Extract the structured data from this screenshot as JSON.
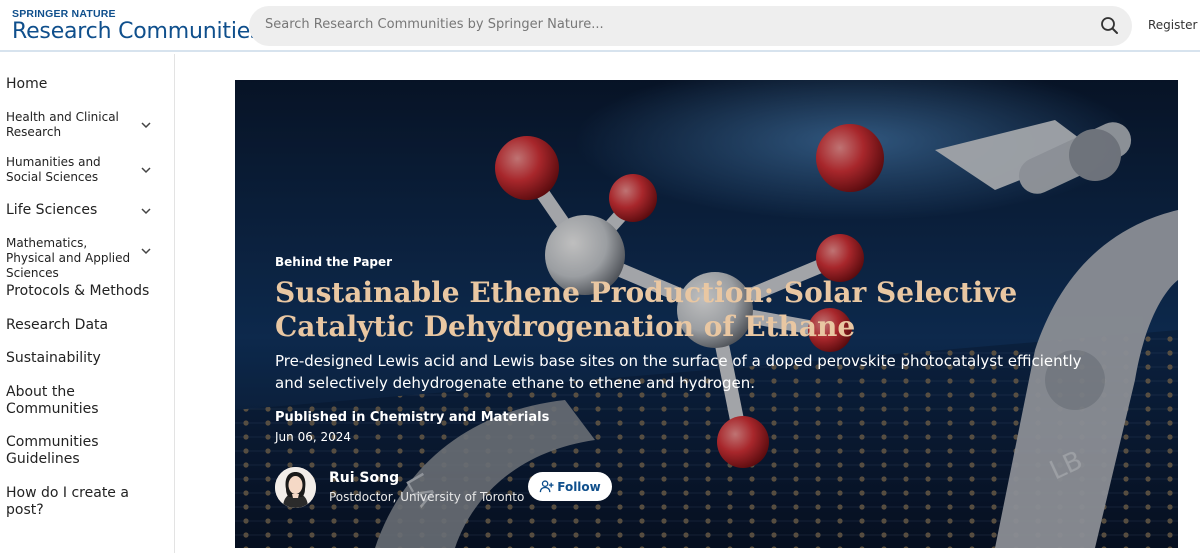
{
  "header": {
    "brand_top": "SPRINGER NATURE",
    "brand_main": "Research Communities",
    "search_placeholder": "Search Research Communities by Springer Nature...",
    "register_label": "Register"
  },
  "sidebar": {
    "items": [
      {
        "label": "Home",
        "has_chevron": false
      },
      {
        "label": "Health and Clinical Research",
        "has_chevron": true
      },
      {
        "label": "Humanities and Social Sciences",
        "has_chevron": true
      },
      {
        "label": "Life Sciences",
        "has_chevron": true
      },
      {
        "label": "Mathematics, Physical and Applied Sciences",
        "has_chevron": true
      },
      {
        "label": "Protocols & Methods",
        "has_chevron": false
      },
      {
        "label": "Research Data",
        "has_chevron": false
      },
      {
        "label": "Sustainability",
        "has_chevron": false
      },
      {
        "label": "About the Communities",
        "has_chevron": false
      },
      {
        "label": "Communities Guidelines",
        "has_chevron": false
      },
      {
        "label": "How do I create a post?",
        "has_chevron": false
      }
    ]
  },
  "hero": {
    "kicker": "Behind the Paper",
    "title": "Sustainable Ethene Production: Solar Selective Catalytic Dehydrogenation of Ethane",
    "subtitle": "Pre-designed Lewis acid and Lewis base sites on the surface of a doped perovskite photocatalyst efficiently and selectively dehydrogenate ethane to ethene and hydrogen.",
    "published_prefix": "Published in ",
    "published_in": "Chemistry and Materials",
    "date": "Jun 06, 2024",
    "arm_label_left": "LA",
    "arm_label_right": "LB"
  },
  "author": {
    "name": "Rui Song",
    "role": "Postdoctor, University of Toronto",
    "follow_label": "Follow"
  },
  "colors": {
    "brand_blue": "#0f4f8c",
    "title_color": "#e9c7a2",
    "search_bg": "#eeeeee",
    "hero_bg": "#0b1830"
  },
  "icons": {
    "search": "search-icon",
    "chevron": "chevron-down-icon",
    "follow": "user-plus-icon"
  }
}
